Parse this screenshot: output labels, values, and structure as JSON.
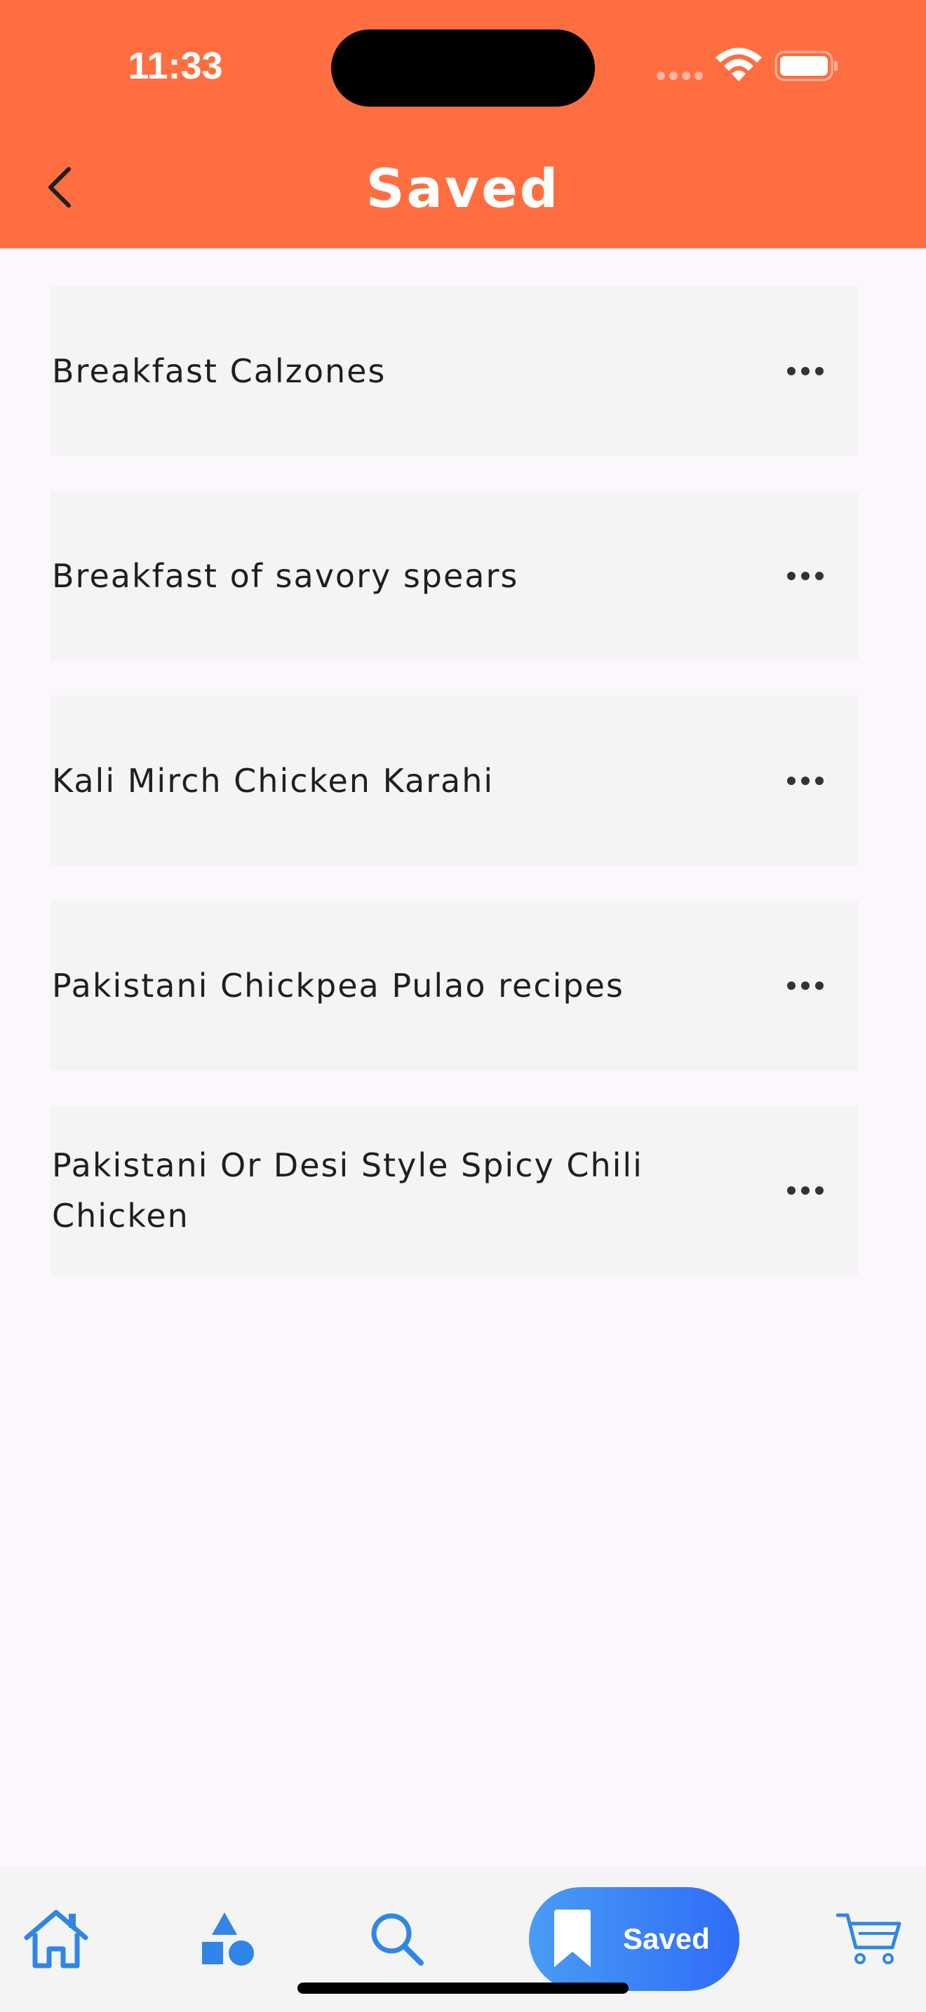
{
  "status_bar": {
    "time": "11:33"
  },
  "header": {
    "title": "Saved",
    "back_icon": "chevron-left-icon"
  },
  "saved_items": [
    {
      "label": "Breakfast Calzones"
    },
    {
      "label": "Breakfast of savory spears"
    },
    {
      "label": "Kali Mirch Chicken Karahi"
    },
    {
      "label": "Pakistani Chickpea Pulao recipes"
    },
    {
      "label": "Pakistani Or Desi Style Spicy Chili Chicken"
    }
  ],
  "bottom_nav": {
    "items": [
      {
        "icon": "home-icon",
        "active": false
      },
      {
        "icon": "categories-icon",
        "active": false
      },
      {
        "icon": "search-icon",
        "active": false
      },
      {
        "icon": "bookmark-icon",
        "label": "Saved",
        "active": true
      },
      {
        "icon": "cart-icon",
        "active": false
      }
    ]
  },
  "colors": {
    "header_bg": "#ff6e40",
    "page_bg": "#fcf6fd",
    "card_bg": "#f4f4f4",
    "nav_icon": "#2f86e6",
    "active_pill_start": "#4a9cf4",
    "active_pill_end": "#2f6cf8"
  }
}
